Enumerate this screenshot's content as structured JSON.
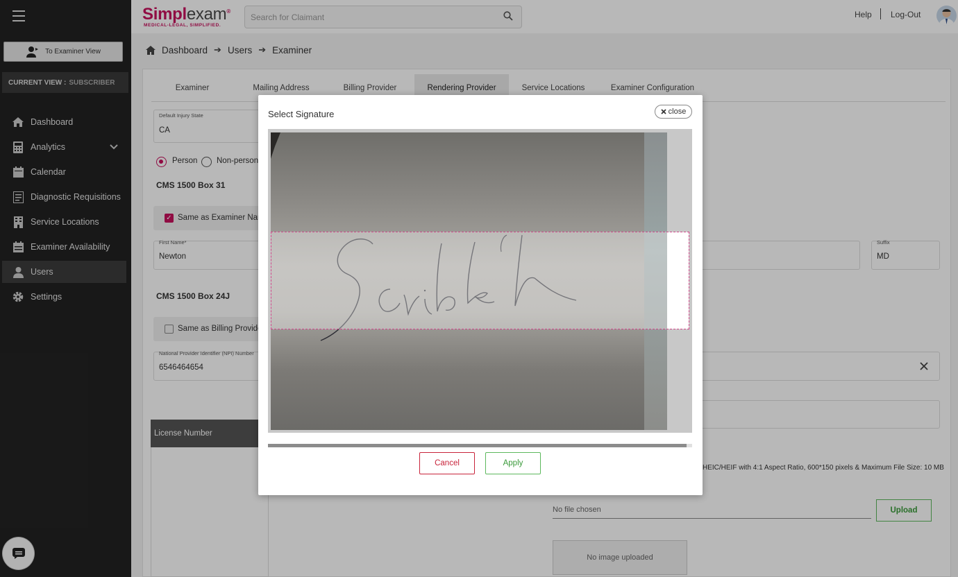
{
  "app": {
    "brand": "Simplexam",
    "brand_part1": "Simpl",
    "brand_part2": "exam",
    "tagline": "MEDICAL-LEGAL, SIMPLIFIED."
  },
  "sidebar": {
    "to_examiner_view": "To Examiner View",
    "current_view_label": "CURRENT VIEW :",
    "current_view_value": "SUBSCRIBER",
    "items": [
      {
        "label": "Dashboard",
        "icon": "home-icon"
      },
      {
        "label": "Analytics",
        "icon": "calculator-icon",
        "expandable": true
      },
      {
        "label": "Calendar",
        "icon": "calendar-icon"
      },
      {
        "label": "Diagnostic Requisitions",
        "icon": "document-icon"
      },
      {
        "label": "Service Locations",
        "icon": "building-icon"
      },
      {
        "label": "Examiner Availability",
        "icon": "calendar-check-icon"
      },
      {
        "label": "Users",
        "icon": "user-icon",
        "active": true
      },
      {
        "label": "Settings",
        "icon": "gear-icon"
      }
    ]
  },
  "header": {
    "search_placeholder": "Search for Claimant",
    "help": "Help",
    "logout": "Log-Out"
  },
  "breadcrumb": [
    "Dashboard",
    "Users",
    "Examiner"
  ],
  "tabs": [
    {
      "label": "Examiner"
    },
    {
      "label": "Mailing Address"
    },
    {
      "label": "Billing Provider"
    },
    {
      "label": "Rendering Provider",
      "active": true
    },
    {
      "label": "Service Locations"
    },
    {
      "label": "Examiner Configuration"
    }
  ],
  "form": {
    "default_injury_state_label": "Default Injury State",
    "default_injury_state_value": "CA",
    "radio_person": "Person",
    "radio_nonperson": "Non-person",
    "section_box31": "CMS 1500 Box 31",
    "same_as_examiner": "Same as Examiner Name",
    "first_name_label": "First Name*",
    "first_name_value": "Newton",
    "suffix_label": "Suffix",
    "suffix_value": "MD",
    "section_box24j": "CMS 1500 Box 24J",
    "same_as_billing": "Same as Billing Provider",
    "npi_label": "National Provider Identifier (NPI) Number",
    "npi_value": "6546464654",
    "license_header": "License Number",
    "file_hint": "HEIC/HEIF with 4:1 Aspect Ratio, 600*150 pixels & Maximum File Size: 10 MB",
    "no_file": "No file chosen",
    "upload": "Upload",
    "no_image": "No image uploaded"
  },
  "modal": {
    "title": "Select Signature",
    "close": "close",
    "cancel": "Cancel",
    "apply": "Apply"
  },
  "colors": {
    "brand": "#c8115e",
    "sidebar_bg": "#222222",
    "cancel": "#c8233a",
    "apply": "#5cb85c"
  }
}
